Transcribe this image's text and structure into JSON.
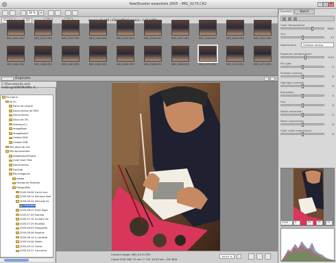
{
  "window": {
    "title": "RawShooter essentials 2005 - IMG_0170.CR2"
  },
  "toolbar": {
    "zoom": "36 %",
    "filter_all": "All (44)",
    "filter_1": "(1)",
    "filter_2": "(2)",
    "filter_3": "(3)",
    "image_info": "Image: 43 / 59 (436.2 MB) Selection: 1 (7.4 MB)"
  },
  "filmstrip": {
    "row1_labels": [
      "IMG_0001.CR2",
      "IMG_0102.CR2",
      "IMG_0103.CR2",
      "IMG_0104.CR2",
      "IMG_0105.CR2",
      "IMG_0106.CR2",
      "IMG_0107.CR2",
      "IMG_0108.CR2",
      "IMG_0109.CR2",
      "IMG_0110.CR2"
    ],
    "row2_labels": [
      "IMG_0161.CR2",
      "IMG_0162.CR2",
      "IMG_0163.CR2",
      "IMG_0164.CR2",
      "IMG_0165.CR2",
      "IMG_0166.CR2",
      "IMG_0168.CR2",
      "IMG_0170.CR2",
      "IMG_0171.CR2",
      "IMG_0172.CR2"
    ]
  },
  "folder_header": "Originales",
  "path": "C:\\Documents and Settings\\DKOMs\\Mis d...",
  "tree": [
    {
      "label": "Escritorio",
      "indent": 0
    },
    {
      "label": "Mi PC",
      "indent": 1
    },
    {
      "label": "Panel de control",
      "indent": 2
    },
    {
      "label": "Documentos de EMO",
      "indent": 2
    },
    {
      "label": "Documentos",
      "indent": 2
    },
    {
      "label": "Disco de 3½",
      "indent": 2
    },
    {
      "label": "Sistema(C:)",
      "indent": 2
    },
    {
      "label": "ImageBook",
      "indent": 2
    },
    {
      "label": "ImageBook2",
      "indent": 2
    },
    {
      "label": "Unidad DVD",
      "indent": 2
    },
    {
      "label": "Unidad USB",
      "indent": 2
    },
    {
      "label": "Mis sitios de red",
      "indent": 1
    },
    {
      "label": "Mis documentos",
      "indent": 1
    },
    {
      "label": "AdobeStockPhotos",
      "indent": 2
    },
    {
      "label": "Corel User Files",
      "indent": 2
    },
    {
      "label": "Documentos",
      "indent": 2
    },
    {
      "label": "FontLab",
      "indent": 2
    },
    {
      "label": "Mis imágenes",
      "indent": 2
    },
    {
      "label": "Adobe",
      "indent": 3
    },
    {
      "label": "Fondos de Pantalla",
      "indent": 3
    },
    {
      "label": "Fotografías",
      "indent": 3
    },
    {
      "label": "2005.06.08 Corrie Aux",
      "indent": 4
    },
    {
      "label": "2005.06.14 Semana Sant",
      "indent": 4
    },
    {
      "label": "2005.06.24 Mercado Fa",
      "indent": 4
    },
    {
      "label": "Originales",
      "indent": 5,
      "selected": true
    },
    {
      "label": "2005.06.25 Feria Algm",
      "indent": 4
    },
    {
      "label": "2005.07.09 Estrella",
      "indent": 4
    },
    {
      "label": "2005.07.10 Cumbre de",
      "indent": 4
    },
    {
      "label": "2005.07.29 Rivaflair",
      "indent": 4
    },
    {
      "label": "2005.08.03 Fotografia",
      "indent": 4
    },
    {
      "label": "2005.08.06 Mujeres",
      "indent": 4
    },
    {
      "label": "2005.08.14 A Cordelle",
      "indent": 4
    },
    {
      "label": "2005.09.06 Otoño",
      "indent": 4
    },
    {
      "label": "2005.09.12 Cierto",
      "indent": 4
    },
    {
      "label": "2005.09.21 Concierto",
      "indent": 4
    }
  ],
  "status": {
    "current_image": "Current image: IMG_0170.CR2",
    "camera": "Canon EOS 20D  70 mm, F 2.8, 1/125 sec., ISO 800",
    "zoom": "16.00 %"
  },
  "right_panel": {
    "tabs": [
      "Correct",
      "Batch convert"
    ],
    "controls": [
      {
        "label": "Color Temperature",
        "value": "5000"
      },
      {
        "label": "Tint",
        "value": "17"
      },
      {
        "label": "Exposure compensation",
        "value": "0.22"
      },
      {
        "label": "Fill Light",
        "value": "0"
      },
      {
        "label": "Shadow contrast",
        "value": "0"
      },
      {
        "label": "Highlight contrast",
        "value": "0"
      },
      {
        "label": "Saturation",
        "value": "0"
      },
      {
        "label": "Hue",
        "value": "0"
      },
      {
        "label": "Detail extraction",
        "value": "0"
      },
      {
        "label": "Noise suppression",
        "value": "0"
      },
      {
        "label": "Color noise suppression",
        "value": "0"
      }
    ],
    "appearance_label": "Appearance",
    "appearance_value": "Outdoor strong",
    "coords": {
      "x": "2345",
      "y": "5",
      "r": "29",
      "g": "13",
      "b": "11"
    }
  }
}
